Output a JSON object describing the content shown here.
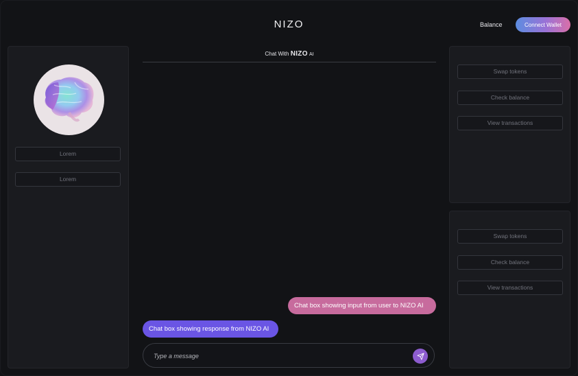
{
  "header": {
    "title": "NIZO",
    "balance_label": "Balance",
    "connect_label": "Connect Wallet"
  },
  "left_panel": {
    "avatar_icon": "brain-icon",
    "buttons": [
      "Lorem",
      "Lorem"
    ]
  },
  "chat": {
    "header_prefix": "Chat With",
    "header_brand": "NIZO",
    "header_suffix": "AI",
    "messages": [
      {
        "role": "user",
        "text": "Chat box showing input from user to  NIZO AI"
      },
      {
        "role": "ai",
        "text": "Chat box showing response from NIZO AI"
      }
    ],
    "input_placeholder": "Type a message",
    "send_icon": "send-icon"
  },
  "right_panel_top": {
    "buttons": [
      "Swap tokens",
      "Check balance",
      "View transactions"
    ]
  },
  "right_panel_bottom": {
    "buttons": [
      "Swap tokens",
      "Check balance",
      "View transactions"
    ]
  },
  "colors": {
    "background": "#121316",
    "panel": "#1a1b1f",
    "user_bubble": "#c76b9d",
    "ai_bubble": "#6a55e4",
    "send_button": "#8d5ccf",
    "connect_gradient": [
      "#5c8de0",
      "#9a72d6",
      "#d96fa8"
    ]
  }
}
